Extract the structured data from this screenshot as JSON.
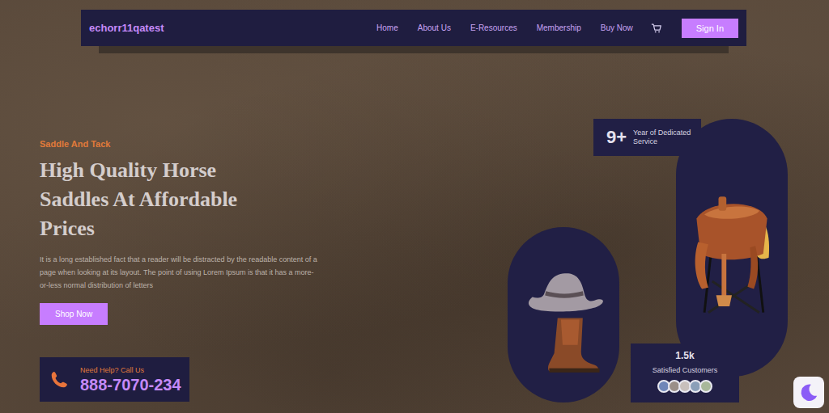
{
  "nav": {
    "logo": "echorr11qatest",
    "links": [
      "Home",
      "About Us",
      "E-Resources",
      "Membership",
      "Buy Now"
    ],
    "sign_in": "Sign In"
  },
  "hero": {
    "eyebrow": "Saddle And Tack",
    "heading": "High Quality Horse Saddles At Affordable Prices",
    "body": "It is a long established fact that a reader will be distracted by the readable content of a page when looking at its layout. The point of using Lorem Ipsum is that it has a more-or-less normal distribution of letters",
    "cta": "Shop Now"
  },
  "help": {
    "label": "Need Help? Call Us",
    "phone": "888-7070-234"
  },
  "stats": {
    "years": "9+",
    "years_label": "Year of Dedicated Service",
    "customers": "1.5k",
    "customers_label": "Satisfied Customers"
  }
}
